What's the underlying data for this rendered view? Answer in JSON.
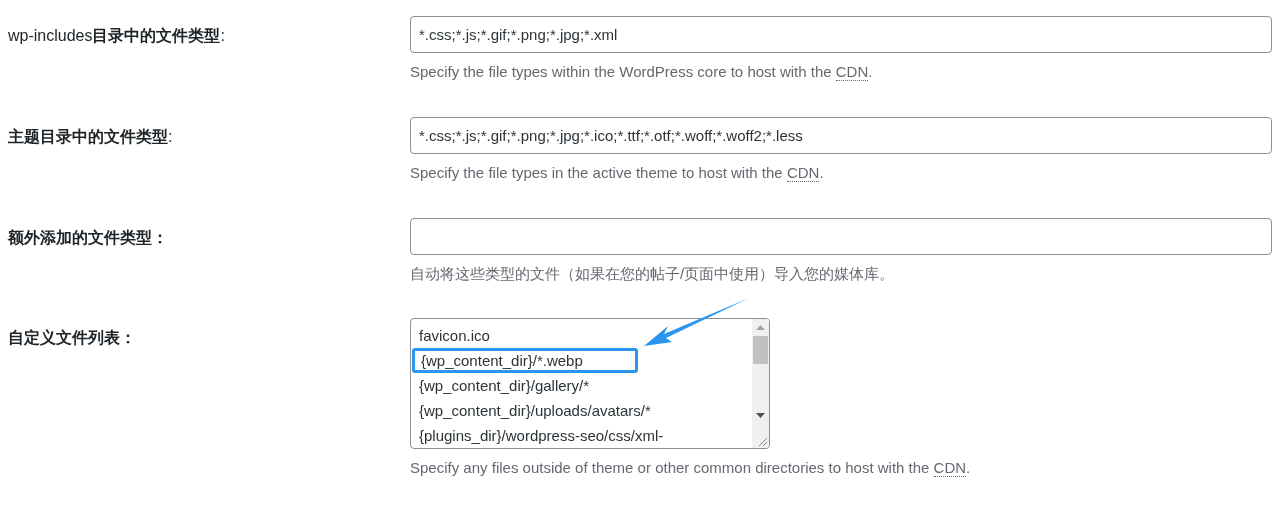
{
  "settings": [
    {
      "kind": "input",
      "label": "wp-includes**目录中的文件类型**:",
      "value": "*.css;*.js;*.gif;*.png;*.jpg;*.xml",
      "description": {
        "text": "Specify the file types within the WordPress core to host with the ",
        "abbr": "CDN",
        "end": "."
      }
    },
    {
      "kind": "input",
      "label": "**主题目录中的文件类型**:",
      "value": "*.css;*.js;*.gif;*.png;*.jpg;*.ico;*.ttf;*.otf;*.woff;*.woff2;*.less",
      "description": {
        "text": "Specify the file types in the active theme to host with the ",
        "abbr": "CDN",
        "end": "."
      }
    },
    {
      "kind": "input",
      "label": "**额外添加的文件类型：**",
      "description": {
        "text": "自动将这些类型的文件（如果在您的帖子/页面中使用）导入您的媒体库。"
      }
    },
    {
      "kind": "textarea",
      "label": "**自定义文件列表：**",
      "lines": [
        {
          "text": "favicon.ico",
          "highlighted": false
        },
        {
          "text": "{wp_content_dir}/*.webp",
          "highlighted": true
        },
        {
          "text": "{wp_content_dir}/gallery/*",
          "highlighted": false
        },
        {
          "text": "{wp_content_dir}/uploads/avatars/*",
          "highlighted": false
        },
        {
          "text": "{plugins_dir}/wordpress-seo/css/xml-",
          "highlighted": false
        }
      ],
      "description": {
        "text": "Specify any files outside of theme or other common directories to host with the ",
        "abbr": "CDN",
        "end": "."
      }
    }
  ]
}
